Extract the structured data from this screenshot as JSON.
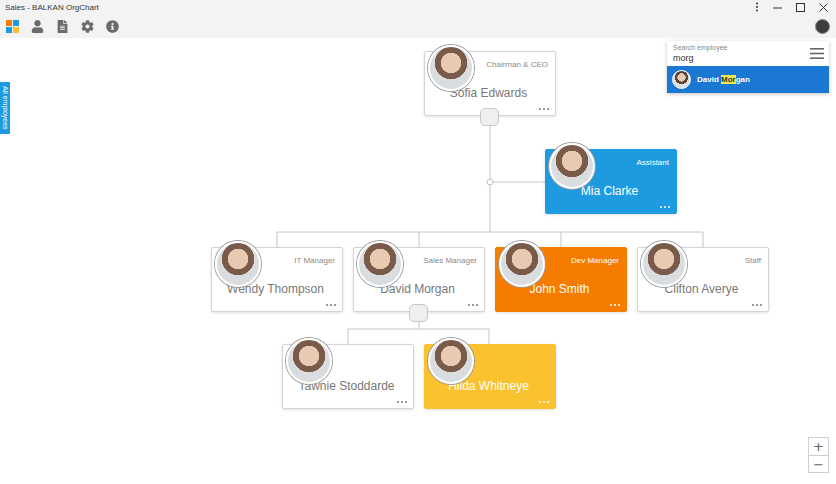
{
  "window": {
    "title": "Sales - BALKAN OrgChart"
  },
  "side_tab": {
    "label": "All employees"
  },
  "search": {
    "label": "Search employee",
    "value": "morg",
    "results": [
      {
        "before": "David ",
        "match": "Mor",
        "after": "gan",
        "selected": true
      }
    ]
  },
  "nodes": [
    {
      "name": "Sofia Edwards",
      "title": "Chairman & CEO",
      "color": "#ffffff",
      "expander": true
    },
    {
      "name": "Mia Clarke",
      "title": "Assistant",
      "color": "#1e9be0",
      "expander": false
    },
    {
      "name": "Wendy Thompson",
      "title": "IT Manager",
      "color": "#ffffff",
      "expander": false
    },
    {
      "name": "David Morgan",
      "title": "Sales Manager",
      "color": "#ffffff",
      "expander": true
    },
    {
      "name": "John Smith",
      "title": "Dev Manager",
      "color": "#f57c00",
      "expander": false
    },
    {
      "name": "Clifton Averye",
      "title": "Staff",
      "color": "#ffffff",
      "expander": false
    },
    {
      "name": "Tawnie Stoddarde",
      "color": "#ffffff",
      "expander": false
    },
    {
      "name": "Hilda Whitneye",
      "title": "",
      "color": "#f9c22e",
      "expander": false
    }
  ],
  "zoom": {
    "in": "+",
    "out": "−"
  }
}
